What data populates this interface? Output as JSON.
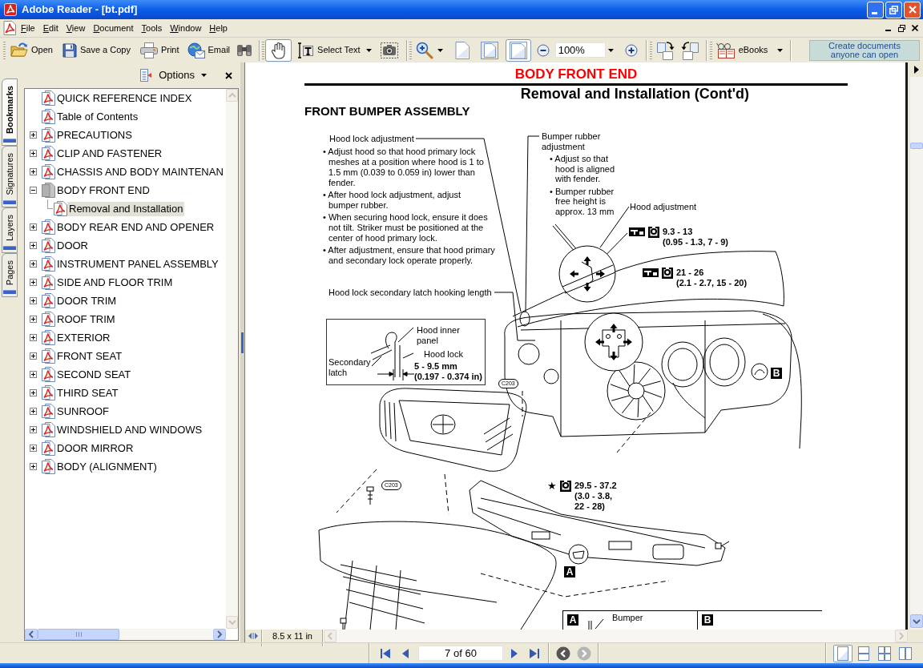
{
  "window": {
    "title": "Adobe Reader - [bt.pdf]"
  },
  "menu": [
    "File",
    "Edit",
    "View",
    "Document",
    "Tools",
    "Window",
    "Help"
  ],
  "toolbar": {
    "file_buttons": [
      {
        "kind": "open",
        "label": "Open"
      },
      {
        "kind": "save",
        "label": "Save a Copy"
      },
      {
        "kind": "print",
        "label": "Print"
      },
      {
        "kind": "email",
        "label": "Email"
      }
    ],
    "tools": [
      {
        "kind": "hand",
        "selected": true
      },
      {
        "kind": "select_text",
        "label": "Select Text",
        "selected": false
      },
      {
        "kind": "snapshot",
        "selected": false
      }
    ],
    "page_views": [
      {
        "kind": "actual_size",
        "selected": false
      },
      {
        "kind": "fit_page",
        "selected": false
      },
      {
        "kind": "fit_width",
        "selected": true
      }
    ],
    "zoom": "100%",
    "ebooks": "eBooks",
    "banner": "Create documents anyone can open"
  },
  "navigation_panel": {
    "tabs": [
      {
        "label": "Bookmarks",
        "selected": true
      },
      {
        "label": "Signatures",
        "selected": false
      },
      {
        "label": "Layers",
        "selected": false
      },
      {
        "label": "Pages",
        "selected": false
      }
    ],
    "options": "Options",
    "bookmarks": [
      {
        "label": "QUICK REFERENCE INDEX",
        "expandable": false,
        "expanded": false,
        "selected": false
      },
      {
        "label": "Table of Contents",
        "expandable": false,
        "expanded": false,
        "selected": false
      },
      {
        "label": "PRECAUTIONS",
        "expandable": true,
        "expanded": false,
        "selected": false
      },
      {
        "label": "CLIP AND FASTENER",
        "expandable": true,
        "expanded": false,
        "selected": false
      },
      {
        "label": "CHASSIS AND BODY MAINTENAN",
        "expandable": true,
        "expanded": false,
        "selected": false
      },
      {
        "label": "BODY FRONT END",
        "expandable": true,
        "expanded": true,
        "selected": false,
        "children": [
          {
            "label": "Removal and Installation",
            "expandable": false,
            "expanded": false,
            "selected": true
          }
        ]
      },
      {
        "label": "BODY REAR END AND OPENER",
        "expandable": true,
        "expanded": false,
        "selected": false
      },
      {
        "label": "DOOR",
        "expandable": true,
        "expanded": false,
        "selected": false
      },
      {
        "label": "INSTRUMENT PANEL ASSEMBLY",
        "expandable": true,
        "expanded": false,
        "selected": false
      },
      {
        "label": "SIDE AND FLOOR TRIM",
        "expandable": true,
        "expanded": false,
        "selected": false
      },
      {
        "label": "DOOR TRIM",
        "expandable": true,
        "expanded": false,
        "selected": false
      },
      {
        "label": "ROOF TRIM",
        "expandable": true,
        "expanded": false,
        "selected": false
      },
      {
        "label": "EXTERIOR",
        "expandable": true,
        "expanded": false,
        "selected": false
      },
      {
        "label": "FRONT SEAT",
        "expandable": true,
        "expanded": false,
        "selected": false
      },
      {
        "label": "SECOND SEAT",
        "expandable": true,
        "expanded": false,
        "selected": false
      },
      {
        "label": "THIRD SEAT",
        "expandable": true,
        "expanded": false,
        "selected": false
      },
      {
        "label": "SUNROOF",
        "expandable": true,
        "expanded": false,
        "selected": false
      },
      {
        "label": "WINDSHIELD AND WINDOWS",
        "expandable": true,
        "expanded": false,
        "selected": false
      },
      {
        "label": "DOOR MIRROR",
        "expandable": true,
        "expanded": false,
        "selected": false
      },
      {
        "label": "BODY (ALIGNMENT)",
        "expandable": true,
        "expanded": false,
        "selected": false
      }
    ]
  },
  "document": {
    "section": "BODY FRONT END",
    "subtitle": "Removal and Installation (Cont'd)",
    "heading": "FRONT BUMPER ASSEMBLY",
    "figure": {
      "hood_lock": {
        "title": "Hood lock adjustment",
        "notes": [
          "• Adjust hood so that hood primary lock meshes at a position where hood is 1 to 1.5 mm (0.039 to 0.059 in) lower than fender.",
          "• After hood lock adjustment, adjust bumper rubber.",
          "• When securing hood lock, ensure it does not tilt. Striker must be positioned at the center of hood primary lock.",
          "• After adjustment, ensure that hood primary and secondary lock operate properly."
        ]
      },
      "latch_length": "Hood lock secondary latch hooking length",
      "inset": {
        "hood_inner_panel": "Hood inner panel",
        "hood_lock": "Hood lock",
        "secondary_latch": "Secondary latch",
        "measurement": "5 - 9.5 mm",
        "measurement_in": "(0.197 - 0.374 in)"
      },
      "bumper_rubber": {
        "title": "Bumper rubber adjustment",
        "notes": [
          "• Adjust so that hood is aligned with fender.",
          "• Bumper rubber free height is approx. 13 mm"
        ]
      },
      "hood_adjustment": "Hood adjustment",
      "torque_specs": [
        {
          "kind": "tool",
          "value": "9.3 - 13",
          "detail": "(0.95 - 1.3, 7 - 9)"
        },
        {
          "kind": "tool",
          "value": "21 - 26",
          "detail": "(2.1 - 2.7, 15 - 20)"
        },
        {
          "kind": "star",
          "symbol": "★",
          "value": "29.5 - 37.2",
          "detail": "(3.0 - 3.8, 22 - 28)"
        }
      ],
      "clip_codes": [
        "C203",
        "C203"
      ],
      "callouts": [
        "B",
        "A"
      ],
      "legend": [
        {
          "letter": "A",
          "label": "Bumper"
        },
        {
          "letter": "B"
        }
      ]
    }
  },
  "status_bar": {
    "page_size": "8.5 x 11 in"
  },
  "page_navigation": {
    "page": "7 of 60",
    "history": [
      {
        "kind": "back",
        "disabled": false
      },
      {
        "kind": "forward",
        "disabled": true
      }
    ],
    "layouts": [
      {
        "kind": "single_page",
        "selected": true
      },
      {
        "kind": "continuous",
        "selected": false
      },
      {
        "kind": "continuous_facing",
        "selected": false
      },
      {
        "kind": "facing",
        "selected": false
      }
    ]
  }
}
